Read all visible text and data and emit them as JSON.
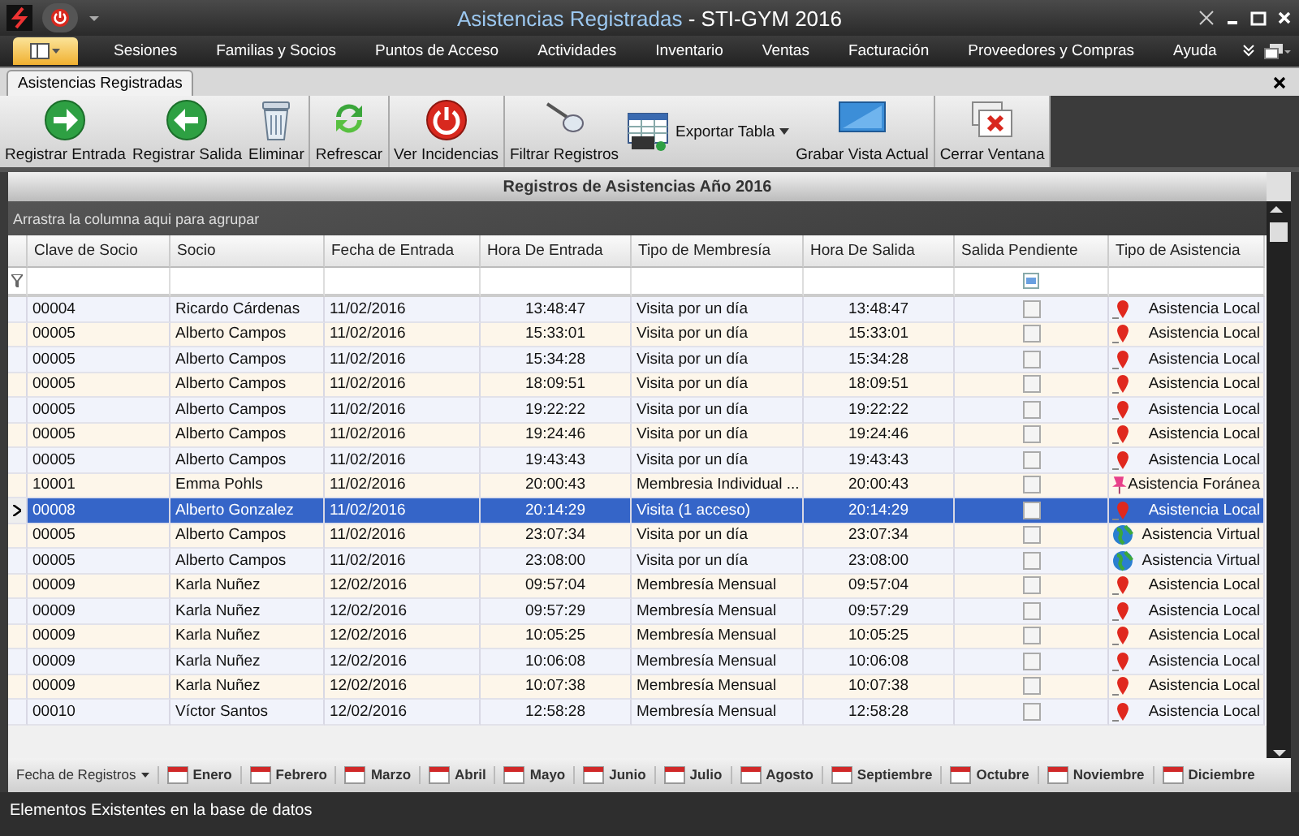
{
  "window": {
    "document": "Asistencias Registradas",
    "app": "- STI-GYM 2016"
  },
  "menu": [
    {
      "label": "Sesiones"
    },
    {
      "label": "Familias y Socios"
    },
    {
      "label": "Puntos de Acceso"
    },
    {
      "label": "Actividades"
    },
    {
      "label": "Inventario"
    },
    {
      "label": "Ventas"
    },
    {
      "label": "Facturación"
    },
    {
      "label": "Proveedores y Compras"
    },
    {
      "label": "Ayuda"
    }
  ],
  "document_tab": {
    "label": "Asistencias Registradas"
  },
  "toolbar": [
    {
      "tools": [
        {
          "label": "Registrar Entrada",
          "kind": "enter"
        },
        {
          "label": "Registrar Salida",
          "kind": "exit"
        },
        {
          "label": "Eliminar",
          "kind": "trash"
        }
      ]
    },
    {
      "tools": [
        {
          "label": "Refrescar",
          "kind": "refresh"
        }
      ]
    },
    {
      "tools": [
        {
          "label": "Ver Incidencias",
          "kind": "alert"
        }
      ]
    },
    {
      "tools": [
        {
          "label": "Filtrar Registros",
          "kind": "filter"
        },
        {
          "label": "Exportar Tabla",
          "kind": "export"
        },
        {
          "label": "Grabar Vista Actual",
          "kind": "save"
        }
      ]
    },
    {
      "tools": [
        {
          "label": "Cerrar Ventana",
          "kind": "close"
        }
      ]
    }
  ],
  "panel": {
    "title": "Registros de Asistencias Año 2016",
    "group_hint": "Arrastra la columna aqui para agrupar"
  },
  "table": {
    "columns": [
      "Clave de Socio",
      "Socio",
      "Fecha de Entrada",
      "Hora De Entrada",
      "Tipo de Membresía",
      "Hora De Salida",
      "Salida Pendiente",
      "Tipo de Asistencia"
    ],
    "rows": [
      {
        "cells": [
          "00004",
          "Ricardo Cárdenas",
          "11/02/2016",
          "13:48:47",
          "Visita por un día",
          "13:48:47"
        ],
        "pending": false,
        "kind": "local",
        "attendance": "Asistencia Local",
        "selected": false
      },
      {
        "cells": [
          "00005",
          "Alberto Campos",
          "11/02/2016",
          "15:33:01",
          "Visita por un día",
          "15:33:01"
        ],
        "pending": false,
        "kind": "local",
        "attendance": "Asistencia Local",
        "selected": false
      },
      {
        "cells": [
          "00005",
          "Alberto Campos",
          "11/02/2016",
          "15:34:28",
          "Visita por un día",
          "15:34:28"
        ],
        "pending": false,
        "kind": "local",
        "attendance": "Asistencia Local",
        "selected": false
      },
      {
        "cells": [
          "00005",
          "Alberto Campos",
          "11/02/2016",
          "18:09:51",
          "Visita por un día",
          "18:09:51"
        ],
        "pending": false,
        "kind": "local",
        "attendance": "Asistencia Local",
        "selected": false
      },
      {
        "cells": [
          "00005",
          "Alberto Campos",
          "11/02/2016",
          "19:22:22",
          "Visita por un día",
          "19:22:22"
        ],
        "pending": false,
        "kind": "local",
        "attendance": "Asistencia Local",
        "selected": false
      },
      {
        "cells": [
          "00005",
          "Alberto Campos",
          "11/02/2016",
          "19:24:46",
          "Visita por un día",
          "19:24:46"
        ],
        "pending": false,
        "kind": "local",
        "attendance": "Asistencia Local",
        "selected": false
      },
      {
        "cells": [
          "00005",
          "Alberto Campos",
          "11/02/2016",
          "19:43:43",
          "Visita por un día",
          "19:43:43"
        ],
        "pending": false,
        "kind": "local",
        "attendance": "Asistencia Local",
        "selected": false
      },
      {
        "cells": [
          "10001",
          "Emma Pohls",
          "11/02/2016",
          "20:00:43",
          "Membresia Individual ...",
          "20:00:43"
        ],
        "pending": false,
        "kind": "foreign",
        "attendance": "Asistencia Foránea",
        "selected": false
      },
      {
        "cells": [
          "00008",
          "Alberto Gonzalez",
          "11/02/2016",
          "20:14:29",
          "Visita (1 acceso)",
          "20:14:29"
        ],
        "pending": false,
        "kind": "local",
        "attendance": "Asistencia Local",
        "selected": true
      },
      {
        "cells": [
          "00005",
          "Alberto Campos",
          "11/02/2016",
          "23:07:34",
          "Visita por un día",
          "23:07:34"
        ],
        "pending": false,
        "kind": "virtual",
        "attendance": "Asistencia Virtual",
        "selected": false
      },
      {
        "cells": [
          "00005",
          "Alberto Campos",
          "11/02/2016",
          "23:08:00",
          "Visita por un día",
          "23:08:00"
        ],
        "pending": false,
        "kind": "virtual",
        "attendance": "Asistencia Virtual",
        "selected": false
      },
      {
        "cells": [
          "00009",
          "Karla Nuñez",
          "12/02/2016",
          "09:57:04",
          "Membresía Mensual",
          "09:57:04"
        ],
        "pending": false,
        "kind": "local",
        "attendance": "Asistencia Local",
        "selected": false
      },
      {
        "cells": [
          "00009",
          "Karla Nuñez",
          "12/02/2016",
          "09:57:29",
          "Membresía Mensual",
          "09:57:29"
        ],
        "pending": false,
        "kind": "local",
        "attendance": "Asistencia Local",
        "selected": false
      },
      {
        "cells": [
          "00009",
          "Karla Nuñez",
          "12/02/2016",
          "10:05:25",
          "Membresía Mensual",
          "10:05:25"
        ],
        "pending": false,
        "kind": "local",
        "attendance": "Asistencia Local",
        "selected": false
      },
      {
        "cells": [
          "00009",
          "Karla Nuñez",
          "12/02/2016",
          "10:06:08",
          "Membresía Mensual",
          "10:06:08"
        ],
        "pending": false,
        "kind": "local",
        "attendance": "Asistencia Local",
        "selected": false
      },
      {
        "cells": [
          "00009",
          "Karla Nuñez",
          "12/02/2016",
          "10:07:38",
          "Membresía Mensual",
          "10:07:38"
        ],
        "pending": false,
        "kind": "local",
        "attendance": "Asistencia Local",
        "selected": false
      },
      {
        "cells": [
          "00010",
          "Víctor Santos",
          "12/02/2016",
          "12:58:28",
          "Membresía Mensual",
          "12:58:28"
        ],
        "pending": false,
        "kind": "local",
        "attendance": "Asistencia Local",
        "selected": false
      }
    ]
  },
  "date_bar": {
    "label": "Fecha de Registros",
    "months": [
      "Enero",
      "Febrero",
      "Marzo",
      "Abril",
      "Mayo",
      "Junio",
      "Julio",
      "Agosto",
      "Septiembre",
      "Octubre",
      "Noviembre",
      "Diciembre"
    ]
  },
  "status_bar": "Elementos Existentes en la base de datos"
}
